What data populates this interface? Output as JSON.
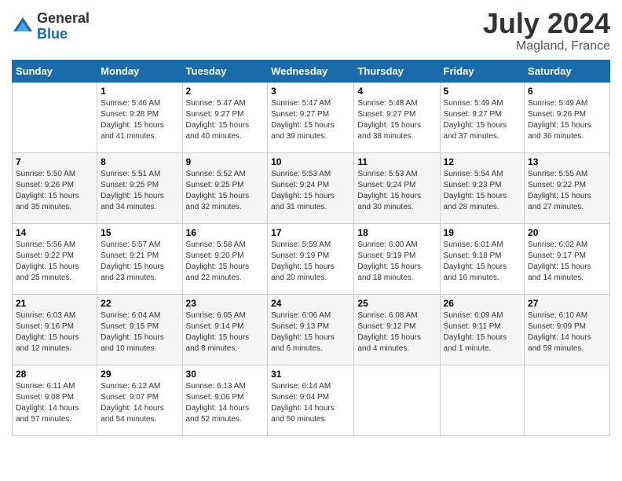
{
  "header": {
    "logo_general": "General",
    "logo_blue": "Blue",
    "month_year": "July 2024",
    "location": "Magland, France"
  },
  "calendar": {
    "days_of_week": [
      "Sunday",
      "Monday",
      "Tuesday",
      "Wednesday",
      "Thursday",
      "Friday",
      "Saturday"
    ],
    "weeks": [
      [
        {
          "day": "",
          "info": ""
        },
        {
          "day": "1",
          "info": "Sunrise: 5:46 AM\nSunset: 9:28 PM\nDaylight: 15 hours\nand 41 minutes."
        },
        {
          "day": "2",
          "info": "Sunrise: 5:47 AM\nSunset: 9:27 PM\nDaylight: 15 hours\nand 40 minutes."
        },
        {
          "day": "3",
          "info": "Sunrise: 5:47 AM\nSunset: 9:27 PM\nDaylight: 15 hours\nand 39 minutes."
        },
        {
          "day": "4",
          "info": "Sunrise: 5:48 AM\nSunset: 9:27 PM\nDaylight: 15 hours\nand 38 minutes."
        },
        {
          "day": "5",
          "info": "Sunrise: 5:49 AM\nSunset: 9:27 PM\nDaylight: 15 hours\nand 37 minutes."
        },
        {
          "day": "6",
          "info": "Sunrise: 5:49 AM\nSunset: 9:26 PM\nDaylight: 15 hours\nand 36 minutes."
        }
      ],
      [
        {
          "day": "7",
          "info": "Sunrise: 5:50 AM\nSunset: 9:26 PM\nDaylight: 15 hours\nand 35 minutes."
        },
        {
          "day": "8",
          "info": "Sunrise: 5:51 AM\nSunset: 9:25 PM\nDaylight: 15 hours\nand 34 minutes."
        },
        {
          "day": "9",
          "info": "Sunrise: 5:52 AM\nSunset: 9:25 PM\nDaylight: 15 hours\nand 32 minutes."
        },
        {
          "day": "10",
          "info": "Sunrise: 5:53 AM\nSunset: 9:24 PM\nDaylight: 15 hours\nand 31 minutes."
        },
        {
          "day": "11",
          "info": "Sunrise: 5:53 AM\nSunset: 9:24 PM\nDaylight: 15 hours\nand 30 minutes."
        },
        {
          "day": "12",
          "info": "Sunrise: 5:54 AM\nSunset: 9:23 PM\nDaylight: 15 hours\nand 28 minutes."
        },
        {
          "day": "13",
          "info": "Sunrise: 5:55 AM\nSunset: 9:22 PM\nDaylight: 15 hours\nand 27 minutes."
        }
      ],
      [
        {
          "day": "14",
          "info": "Sunrise: 5:56 AM\nSunset: 9:22 PM\nDaylight: 15 hours\nand 25 minutes."
        },
        {
          "day": "15",
          "info": "Sunrise: 5:57 AM\nSunset: 9:21 PM\nDaylight: 15 hours\nand 23 minutes."
        },
        {
          "day": "16",
          "info": "Sunrise: 5:58 AM\nSunset: 9:20 PM\nDaylight: 15 hours\nand 22 minutes."
        },
        {
          "day": "17",
          "info": "Sunrise: 5:59 AM\nSunset: 9:19 PM\nDaylight: 15 hours\nand 20 minutes."
        },
        {
          "day": "18",
          "info": "Sunrise: 6:00 AM\nSunset: 9:19 PM\nDaylight: 15 hours\nand 18 minutes."
        },
        {
          "day": "19",
          "info": "Sunrise: 6:01 AM\nSunset: 9:18 PM\nDaylight: 15 hours\nand 16 minutes."
        },
        {
          "day": "20",
          "info": "Sunrise: 6:02 AM\nSunset: 9:17 PM\nDaylight: 15 hours\nand 14 minutes."
        }
      ],
      [
        {
          "day": "21",
          "info": "Sunrise: 6:03 AM\nSunset: 9:16 PM\nDaylight: 15 hours\nand 12 minutes."
        },
        {
          "day": "22",
          "info": "Sunrise: 6:04 AM\nSunset: 9:15 PM\nDaylight: 15 hours\nand 10 minutes."
        },
        {
          "day": "23",
          "info": "Sunrise: 6:05 AM\nSunset: 9:14 PM\nDaylight: 15 hours\nand 8 minutes."
        },
        {
          "day": "24",
          "info": "Sunrise: 6:06 AM\nSunset: 9:13 PM\nDaylight: 15 hours\nand 6 minutes."
        },
        {
          "day": "25",
          "info": "Sunrise: 6:08 AM\nSunset: 9:12 PM\nDaylight: 15 hours\nand 4 minutes."
        },
        {
          "day": "26",
          "info": "Sunrise: 6:09 AM\nSunset: 9:11 PM\nDaylight: 15 hours\nand 1 minute."
        },
        {
          "day": "27",
          "info": "Sunrise: 6:10 AM\nSunset: 9:09 PM\nDaylight: 14 hours\nand 59 minutes."
        }
      ],
      [
        {
          "day": "28",
          "info": "Sunrise: 6:11 AM\nSunset: 9:08 PM\nDaylight: 14 hours\nand 57 minutes."
        },
        {
          "day": "29",
          "info": "Sunrise: 6:12 AM\nSunset: 9:07 PM\nDaylight: 14 hours\nand 54 minutes."
        },
        {
          "day": "30",
          "info": "Sunrise: 6:13 AM\nSunset: 9:06 PM\nDaylight: 14 hours\nand 52 minutes."
        },
        {
          "day": "31",
          "info": "Sunrise: 6:14 AM\nSunset: 9:04 PM\nDaylight: 14 hours\nand 50 minutes."
        },
        {
          "day": "",
          "info": ""
        },
        {
          "day": "",
          "info": ""
        },
        {
          "day": "",
          "info": ""
        }
      ]
    ]
  }
}
